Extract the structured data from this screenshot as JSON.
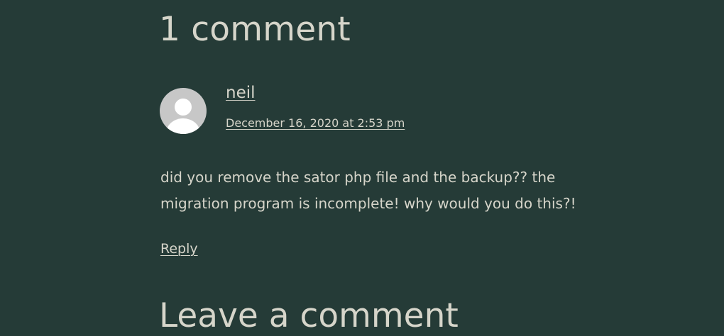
{
  "comments": {
    "heading": "1 comment",
    "items": [
      {
        "avatar_icon": "user-silhouette-icon",
        "author": "neil",
        "date": "December 16, 2020 at 2:53 pm",
        "body": "did you remove the sator php file and the backup?? the migration program is incomplete! why would you do this?!",
        "reply_label": "Reply"
      }
    ]
  },
  "reply_section": {
    "heading": "Leave a comment"
  },
  "colors": {
    "background": "#253b37",
    "text": "#d6d5ca",
    "avatar": "#c7c7c7"
  }
}
